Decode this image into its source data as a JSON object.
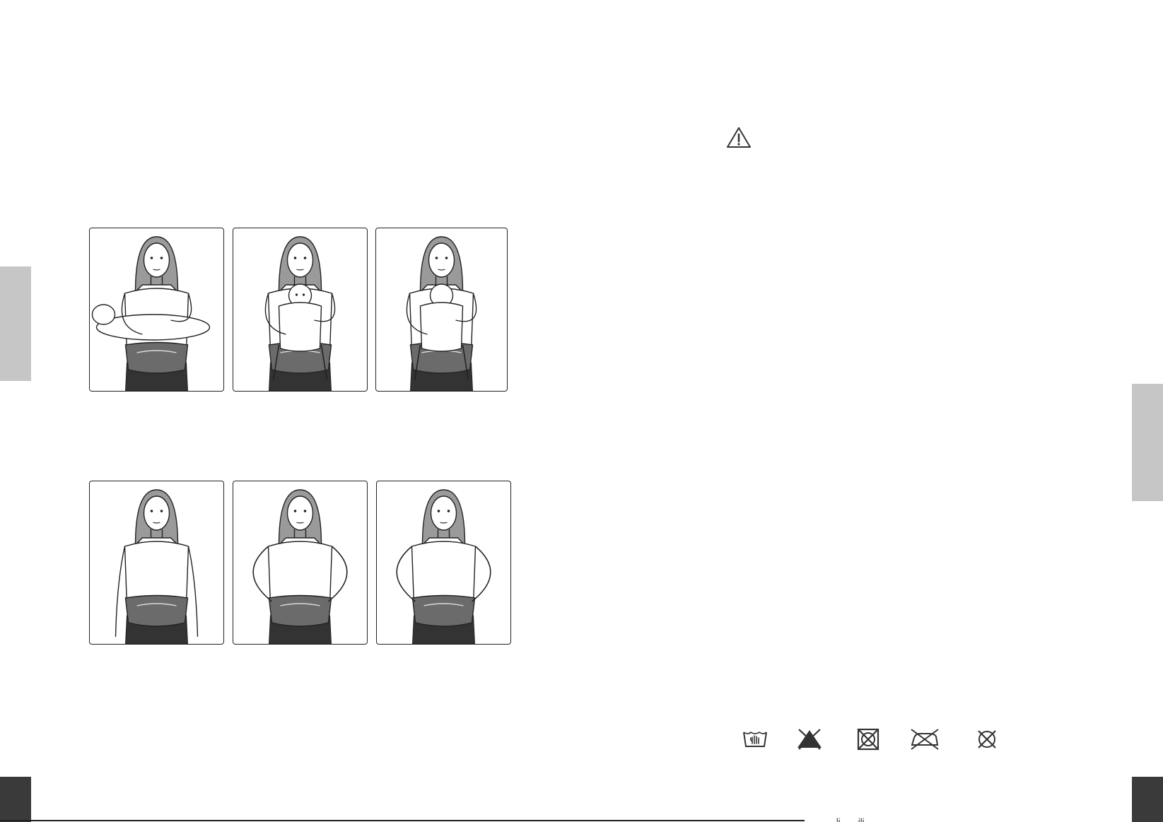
{
  "illustrations": {
    "row1": [
      {
        "name": "carry-hip-side-illustration",
        "pose": "baby-horizontal"
      },
      {
        "name": "carry-front-facing-out-illustration",
        "pose": "baby-facing-out"
      },
      {
        "name": "carry-front-facing-in-illustration",
        "pose": "baby-facing-in"
      }
    ],
    "row2": [
      {
        "name": "belt-fastened-illustration",
        "pose": "arms-down"
      },
      {
        "name": "seat-opened-illustration",
        "pose": "hands-on-hips"
      },
      {
        "name": "seat-adjusted-illustration",
        "pose": "hands-on-hips"
      }
    ]
  },
  "warning": {
    "icon": "warning-triangle-icon"
  },
  "care_symbols": [
    {
      "icon": "hand-wash-icon"
    },
    {
      "icon": "do-not-bleach-icon"
    },
    {
      "icon": "do-not-tumble-dry-icon"
    },
    {
      "icon": "do-not-iron-icon"
    },
    {
      "icon": "do-not-dry-clean-icon"
    }
  ],
  "footer": {
    "text": "...li... ...ili..."
  },
  "colors": {
    "tab": "#c6c6c6",
    "corner": "#3a3a3a",
    "line": "#222222",
    "garment": "#6b6b6b",
    "hair": "#9a9a9a"
  }
}
